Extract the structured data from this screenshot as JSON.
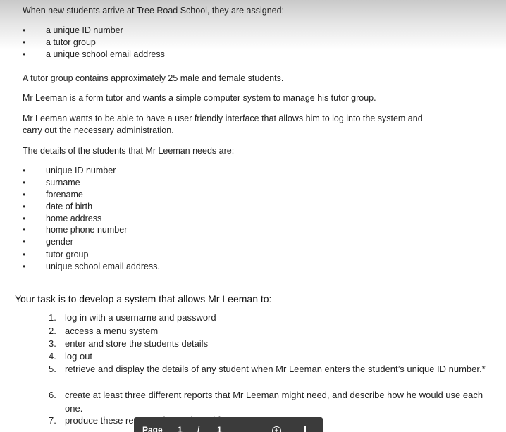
{
  "intro": "When new students arrive at Tree Road School, they are assigned:",
  "assigned": [
    "a unique ID number",
    "a tutor group",
    "a unique school email address"
  ],
  "bullet_glyph": "•",
  "para1": "A tutor group contains approximately 25 male and female students.",
  "para2": "Mr Leeman is a form tutor and wants a simple computer system to manage his tutor group.",
  "para3_line1": "Mr Leeman wants to be able to have a user friendly interface that allows him to log into the system and",
  "para3_line2": "carry out the necessary administration.",
  "para4": "The details of the students that Mr Leeman needs are:",
  "details": [
    "unique ID number",
    "surname",
    "forename",
    "date of birth",
    "home address",
    "home phone number",
    "gender",
    "tutor group",
    "unique school email address."
  ],
  "task_heading": "Your task is to develop a system that allows Mr Leeman to:",
  "tasks": [
    {
      "n": "1.",
      "text": "log in with a username and password"
    },
    {
      "n": "2.",
      "text": "access a menu system"
    },
    {
      "n": "3.",
      "text": "enter and store the students details"
    },
    {
      "n": "4.",
      "text": "log out"
    },
    {
      "n": "5.",
      "text": "retrieve and display the details of any student when Mr Leeman enters the student’s unique ID number.*"
    },
    {
      "n": "6.",
      "text": "create at least three different reports that Mr Leeman might need, and describe how he would use each one."
    },
    {
      "n": "7.",
      "text": "produce these reports when selected from a menu."
    }
  ],
  "toolbar": {
    "label": "Page",
    "current": "1",
    "separator": "/",
    "total": "1",
    "zoom_icon": "zoom-in-icon",
    "download_icon": "download-icon"
  }
}
